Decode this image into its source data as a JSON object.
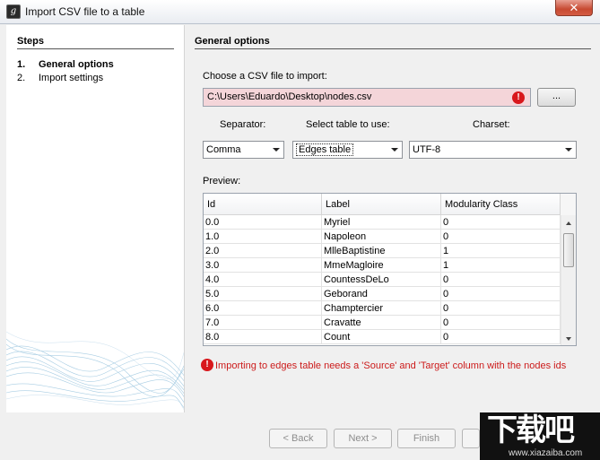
{
  "window": {
    "title": "Import CSV file to a table",
    "close_glyph": "✕"
  },
  "steps": {
    "title": "Steps",
    "items": [
      {
        "num": "1.",
        "label": "General options",
        "active": true
      },
      {
        "num": "2.",
        "label": "Import settings",
        "active": false
      }
    ]
  },
  "main": {
    "title": "General options",
    "file_label": "Choose a CSV file to import:",
    "file_value": "C:\\Users\\Eduardo\\Desktop\\nodes.csv",
    "browse_label": "...",
    "separator_label": "Separator:",
    "table_label": "Select table to use:",
    "charset_label": "Charset:",
    "separator_value": "Comma",
    "table_value": "Edges table",
    "charset_value": "UTF-8",
    "preview_label": "Preview:",
    "columns": [
      "Id",
      "Label",
      "Modularity Class"
    ],
    "rows": [
      [
        "0.0",
        "Myriel",
        "0"
      ],
      [
        "1.0",
        "Napoleon",
        "0"
      ],
      [
        "2.0",
        "MlleBaptistine",
        "1"
      ],
      [
        "3.0",
        "MmeMagloire",
        "1"
      ],
      [
        "4.0",
        "CountessDeLo",
        "0"
      ],
      [
        "5.0",
        "Geborand",
        "0"
      ],
      [
        "6.0",
        "Champtercier",
        "0"
      ],
      [
        "7.0",
        "Cravatte",
        "0"
      ],
      [
        "8.0",
        "Count",
        "0"
      ]
    ],
    "warning": "Importing to edges table needs a 'Source' and 'Target' column with the nodes ids"
  },
  "buttons": {
    "back": "< Back",
    "next": "Next >",
    "finish": "Finish"
  },
  "watermark": {
    "big": "下载吧",
    "small": "www.xiazaiba.com"
  },
  "colors": {
    "error": "#d8171c",
    "input_error_bg": "#f4d5d9"
  }
}
